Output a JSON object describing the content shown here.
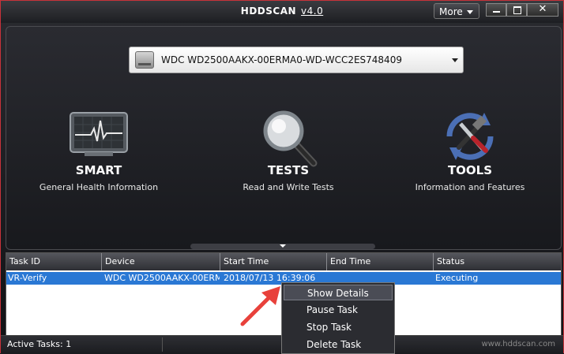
{
  "titlebar": {
    "title": "HDDSCAN",
    "version": "v4.0",
    "more_label": "More",
    "close_glyph": "✕"
  },
  "drive_selector": {
    "selected": "WDC WD2500AAKX-00ERMA0-WD-WCC2ES748409"
  },
  "features": [
    {
      "label": "SMART",
      "subtitle": "General Health Information",
      "icon": "heartbeat-monitor-icon"
    },
    {
      "label": "TESTS",
      "subtitle": "Read and Write Tests",
      "icon": "magnifier-icon"
    },
    {
      "label": "TOOLS",
      "subtitle": "Information and Features",
      "icon": "tools-icon"
    }
  ],
  "task_table": {
    "columns": [
      "Task ID",
      "Device",
      "Start Time",
      "End Time",
      "Status"
    ],
    "rows": [
      {
        "task_id": "VR-Verify",
        "device": "WDC WD2500AAKX-00ERM…",
        "start_time": "2018/07/13 16:39:06",
        "end_time": "",
        "status": "Executing"
      }
    ]
  },
  "context_menu": {
    "items": [
      "Show Details",
      "Pause Task",
      "Stop Task",
      "Delete Task"
    ]
  },
  "statusbar": {
    "active_tasks": "Active Tasks: 1",
    "website": "www.hddscan.com"
  },
  "colors": {
    "window_border": "#c8323a",
    "selection": "#2a78d4",
    "arrow": "#e8413b"
  }
}
